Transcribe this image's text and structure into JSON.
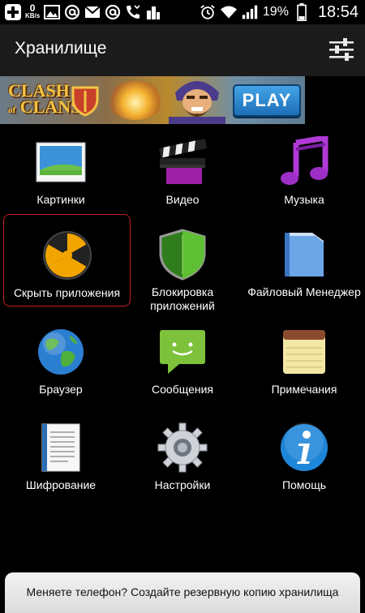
{
  "status_bar": {
    "left_icons": [
      "plus-notification-icon",
      "kbs-indicator",
      "image-icon",
      "at-icon",
      "mail-icon",
      "at-icon",
      "missed-call-icon",
      "building-icon"
    ],
    "kbs_value": "0",
    "kbs_unit": "KB/s",
    "battery_percent": "19%",
    "time": "18:54"
  },
  "app_bar": {
    "title": "Хранилище",
    "settings_icon": "sliders-icon"
  },
  "ad": {
    "logo_line1": "CLASH",
    "logo_of": "of",
    "logo_line2": "CLANS",
    "play_label": "PLAY"
  },
  "grid": {
    "items": [
      {
        "label": "Картинки",
        "icon": "pictures-icon"
      },
      {
        "label": "Видео",
        "icon": "video-icon"
      },
      {
        "label": "Музыка",
        "icon": "music-icon"
      },
      {
        "label": "Скрыть приложения",
        "icon": "radiation-icon"
      },
      {
        "label": "Блокировка приложений",
        "icon": "shield-icon"
      },
      {
        "label": "Файловый Менеджер",
        "icon": "folder-icon"
      },
      {
        "label": "Браузер",
        "icon": "globe-icon"
      },
      {
        "label": "Сообщения",
        "icon": "message-icon"
      },
      {
        "label": "Примечания",
        "icon": "notepad-icon"
      },
      {
        "label": "Шифрование",
        "icon": "document-icon"
      },
      {
        "label": "Настройки",
        "icon": "gear-icon"
      },
      {
        "label": "Помощь",
        "icon": "info-icon"
      }
    ]
  },
  "bottom_banner": {
    "text": "Меняете телефон? Создайте резервную копию хранилища"
  },
  "colors": {
    "background": "#000000",
    "app_bar": "#1b1b1b",
    "selection_border": "#c01f1f"
  }
}
